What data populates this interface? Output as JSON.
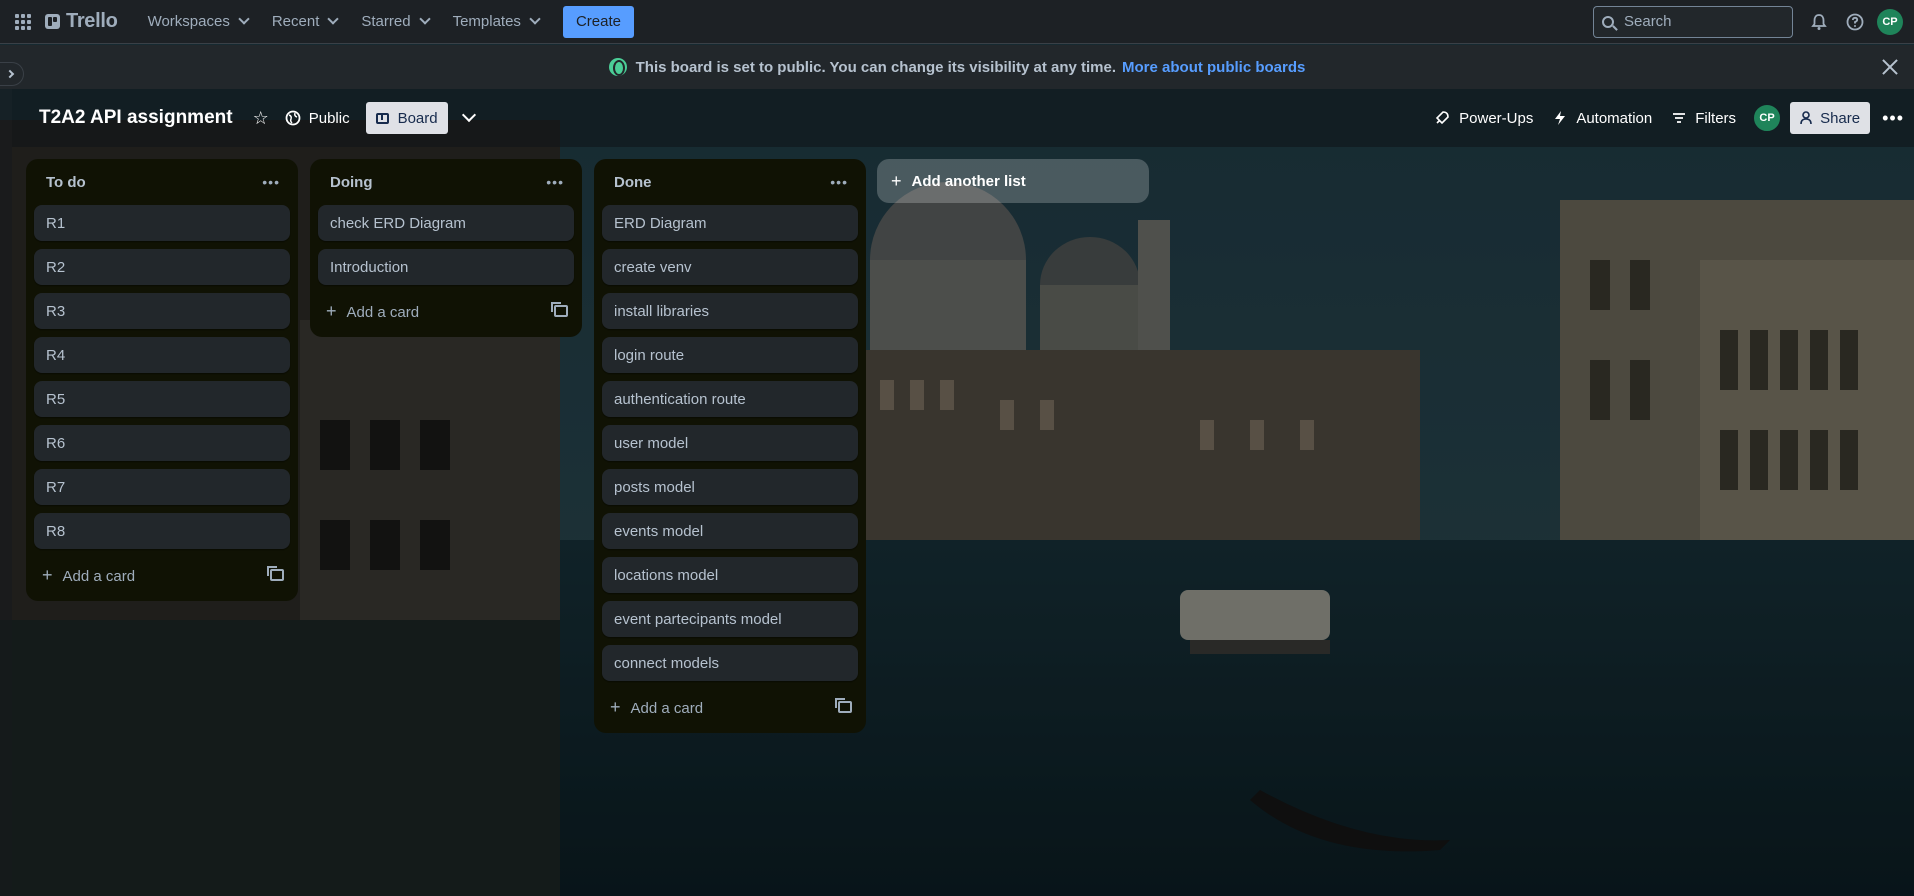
{
  "topnav": {
    "logo": "Trello",
    "menu": [
      {
        "label": "Workspaces"
      },
      {
        "label": "Recent"
      },
      {
        "label": "Starred"
      },
      {
        "label": "Templates"
      }
    ],
    "create_label": "Create",
    "search_placeholder": "Search",
    "avatar_initials": "CP"
  },
  "banner": {
    "text": "This board is set to public. You can change its visibility at any time.",
    "link": "More about public boards"
  },
  "board": {
    "title": "T2A2 API assignment",
    "visibility_label": "Public",
    "view_label": "Board",
    "power_ups_label": "Power-Ups",
    "automation_label": "Automation",
    "filters_label": "Filters",
    "member_initials": "CP",
    "share_label": "Share"
  },
  "lists": [
    {
      "title": "To do",
      "cards": [
        "R1",
        "R2",
        "R3",
        "R4",
        "R5",
        "R6",
        "R7",
        "R8"
      ],
      "add_label": "Add a card"
    },
    {
      "title": "Doing",
      "cards": [
        "check ERD Diagram",
        "Introduction"
      ],
      "add_label": "Add a card"
    },
    {
      "title": "Done",
      "cards": [
        "ERD Diagram",
        "create venv",
        "install libraries",
        "login route",
        "authentication route",
        "user model",
        "posts model",
        "events model",
        "locations model",
        "event partecipants model",
        "connect models"
      ],
      "add_label": "Add a card"
    }
  ],
  "add_list_label": "Add another list",
  "colors": {
    "accent": "#579dff",
    "create_button": "#579dff",
    "avatar": "#1f845a",
    "list_bg": "#101204",
    "card_bg": "#22272b"
  }
}
